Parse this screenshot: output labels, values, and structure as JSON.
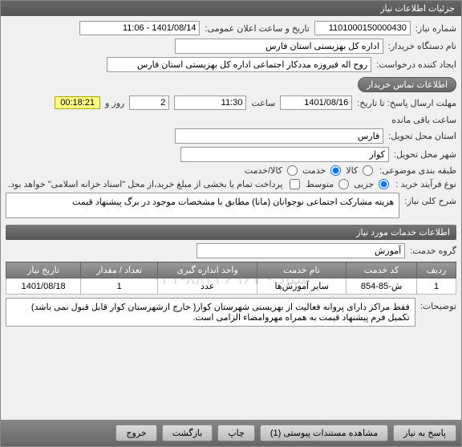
{
  "window": {
    "title": "جزئیات اطلاعات نیاز"
  },
  "fields": {
    "need_no_label": "شماره نیاز:",
    "need_no": "1101000150000430",
    "announce_label": "تاریخ و ساعت اعلان عمومی:",
    "announce": "1401/08/14 - 11:06",
    "buyer_org_label": "نام دستگاه خریدار:",
    "buyer_org": "اداره کل بهزیستی استان فارس",
    "creator_label": "ایجاد کننده درخواست:",
    "creator": "روح اله فیروزه مددکار اجتماعی اداره کل بهزیستی استان فارس",
    "contact_btn": "اطلاعات تماس خریدار",
    "deadline_label": "مهلت ارسال پاسخ: تا تاریخ:",
    "deadline_date": "1401/08/16",
    "time_label": "ساعت",
    "deadline_time": "11:30",
    "days_label": "روز و",
    "days": "2",
    "remain": "00:18:21",
    "remain_label": "ساعت باقی مانده",
    "province_label": "استان محل تحویل:",
    "province": "فارس",
    "city_label": "شهر محل تحویل:",
    "city": "کوار",
    "category_label": "طبقه بندی موضوعی:",
    "cat_goods": "کالا",
    "cat_service": "خدمت",
    "cat_both": "کالا/خدمت",
    "purchase_type_label": "نوع فرآیند خرید :",
    "pt_small": "جزیی",
    "pt_medium": "متوسط",
    "pay_note": "پرداخت تمام یا بخشی از مبلغ خرید،از محل \"اسناد خزانه اسلامی\" خواهد بود.",
    "need_desc_label": "شرح کلی نیاز:",
    "need_desc": "هزینه مشارکت اجتماعی نوجوانان (مانا) مطابق با مشخصات موجود در برگ پیشنهاد قیمت",
    "section_services": "اطلاعات خدمات مورد نیاز",
    "service_group_label": "گروه خدمت:",
    "service_group": "آموزش",
    "notes_label": "توضیحات:",
    "notes": "فقط مراکز دارای پروانه فعالیت از بهزیستی شهرستان کوار( خارج ازشهرستان  کوار  قابل قبول نمی باشد)\nتکمیل فرم پیشنهاد قیمت به همراه مهروامضاء الزامی است."
  },
  "table": {
    "headers": [
      "ردیف",
      "کد خدمت",
      "نام خدمت",
      "واحد اندازه گیری",
      "تعداد / مقدار",
      "تاریخ نیاز"
    ],
    "rows": [
      {
        "idx": "1",
        "code": "ش-85-854",
        "name": "سایر آموزش‌ها",
        "unit": "عدد",
        "qty": "1",
        "date": "1401/08/18"
      }
    ]
  },
  "watermark": "ستاد - ۸۸۳۲۶۹۶۷-۰۲۱",
  "footer": {
    "reply": "پاسخ به نیاز",
    "attach": "مشاهده مستندات پیوستی (1)",
    "print": "چاپ",
    "back": "بازگشت",
    "exit": "خروج"
  }
}
